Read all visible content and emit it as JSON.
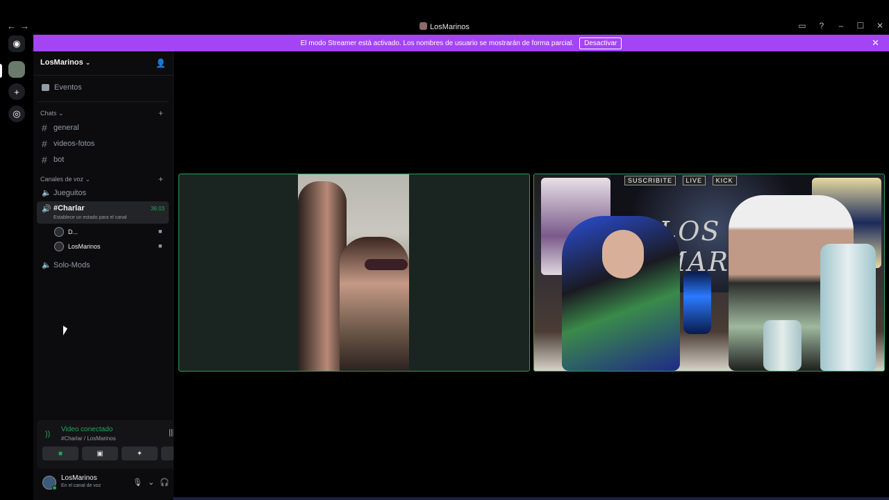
{
  "window": {
    "title": "LosMarinos",
    "nav_back": "←",
    "nav_forward": "→",
    "inbox_icon": "inbox-icon",
    "help_icon": "help-icon",
    "minimize": "–",
    "maximize": "☐",
    "close": "✕"
  },
  "banner": {
    "text": "El modo Streamer está activado. Los nombres de usuario se mostrarán de forma parcial.",
    "button": "Desactivar",
    "close": "✕",
    "color": "#a444f5"
  },
  "server": {
    "name": "LosMarinos",
    "events": "Eventos",
    "categories": {
      "chats": "Chats",
      "voice": "Canales de voz"
    },
    "text_channels": [
      "general",
      "videos-fotos",
      "bot"
    ],
    "voice_channels": {
      "first": "Jueguitos",
      "active": {
        "name": "#Charlar",
        "time": "36:03",
        "status": "Establece un estado para el canal"
      },
      "members": [
        "D...",
        "LosMarinos"
      ],
      "last": "Solo-Mods"
    }
  },
  "voice_panel": {
    "title": "Video conectado",
    "subtitle": "#Charlar / LosMarinos",
    "accent": "#23a55a"
  },
  "user": {
    "name": "LosMarinos",
    "status": "En el canal de voz"
  },
  "stream": {
    "overlay_labels": [
      "SUSCRIBITE",
      "LIVE",
      "KICK"
    ],
    "banner_text": "LOS MARINOS"
  }
}
